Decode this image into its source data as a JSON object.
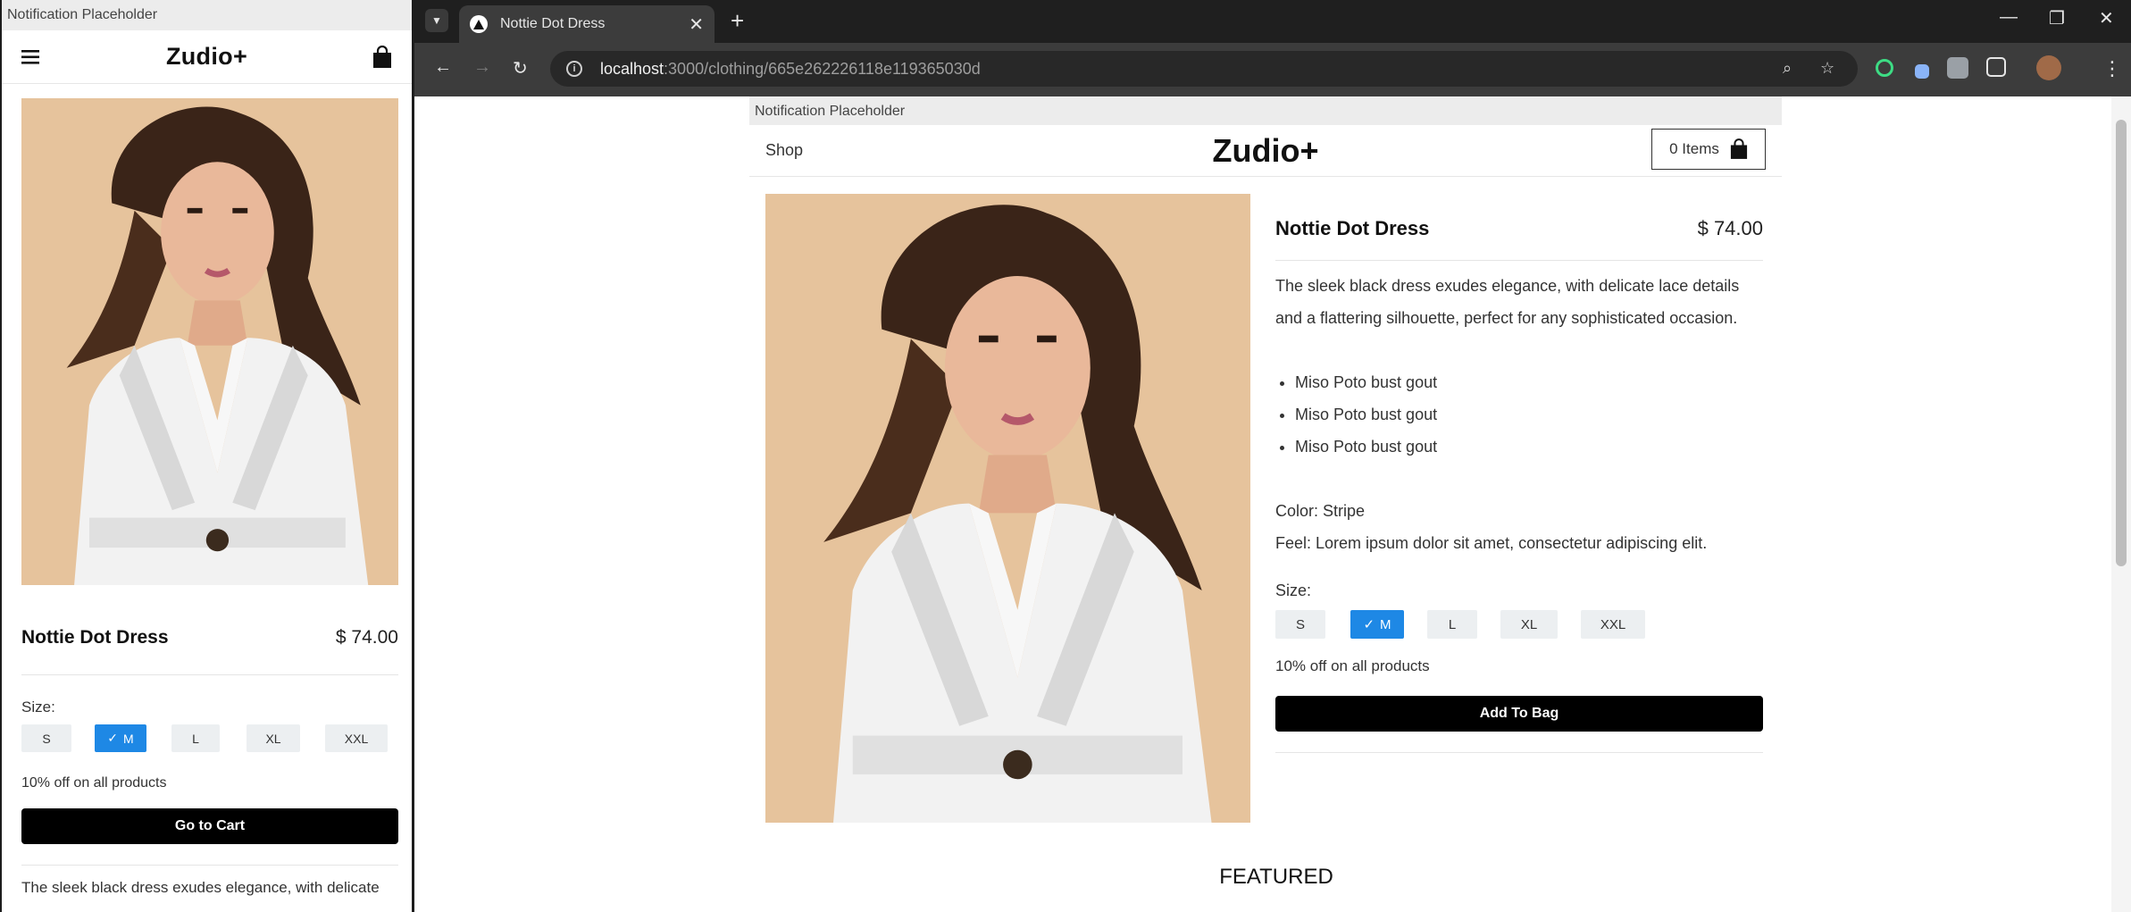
{
  "phone": {
    "notification": "Notification Placeholder",
    "logo": "Zudio+",
    "product": {
      "title": "Nottie Dot Dress",
      "price": "$ 74.00",
      "size_label": "Size:",
      "sizes": [
        "S",
        "M",
        "L",
        "XL",
        "XXL"
      ],
      "selected_size": "M",
      "discount": "10% off on all products",
      "cta": "Go to Cart",
      "description_snippet": "The sleek black dress exudes elegance, with delicate"
    }
  },
  "browser": {
    "tab_title": "Nottie Dot Dress",
    "url_host": "localhost",
    "url_path": ":3000/clothing/665e262226118e119365030d"
  },
  "site": {
    "notification": "Notification Placeholder",
    "nav_shop": "Shop",
    "logo": "Zudio+",
    "bag_label": "0 Items",
    "product": {
      "title": "Nottie Dot Dress",
      "price": "$ 74.00",
      "description": "The sleek black dress exudes elegance, with delicate lace details and a flattering silhouette, perfect for any sophisticated occasion.",
      "features": [
        "Miso Poto bust gout",
        "Miso Poto bust gout",
        "Miso Poto bust gout"
      ],
      "color": "Color: Stripe",
      "feel": "Feel: Lorem ipsum dolor sit amet, consectetur adipiscing elit.",
      "size_label": "Size:",
      "sizes": [
        "S",
        "M",
        "L",
        "XL",
        "XXL"
      ],
      "selected_size": "M",
      "discount": "10% off on all products",
      "cta": "Add To Bag"
    },
    "featured_heading": "FEATURED"
  },
  "colors": {
    "accent": "#1e88e5",
    "browser_frame": "#3c3c3c",
    "tabbar": "#1f1f1f",
    "image_bg": "#e8c49c"
  }
}
